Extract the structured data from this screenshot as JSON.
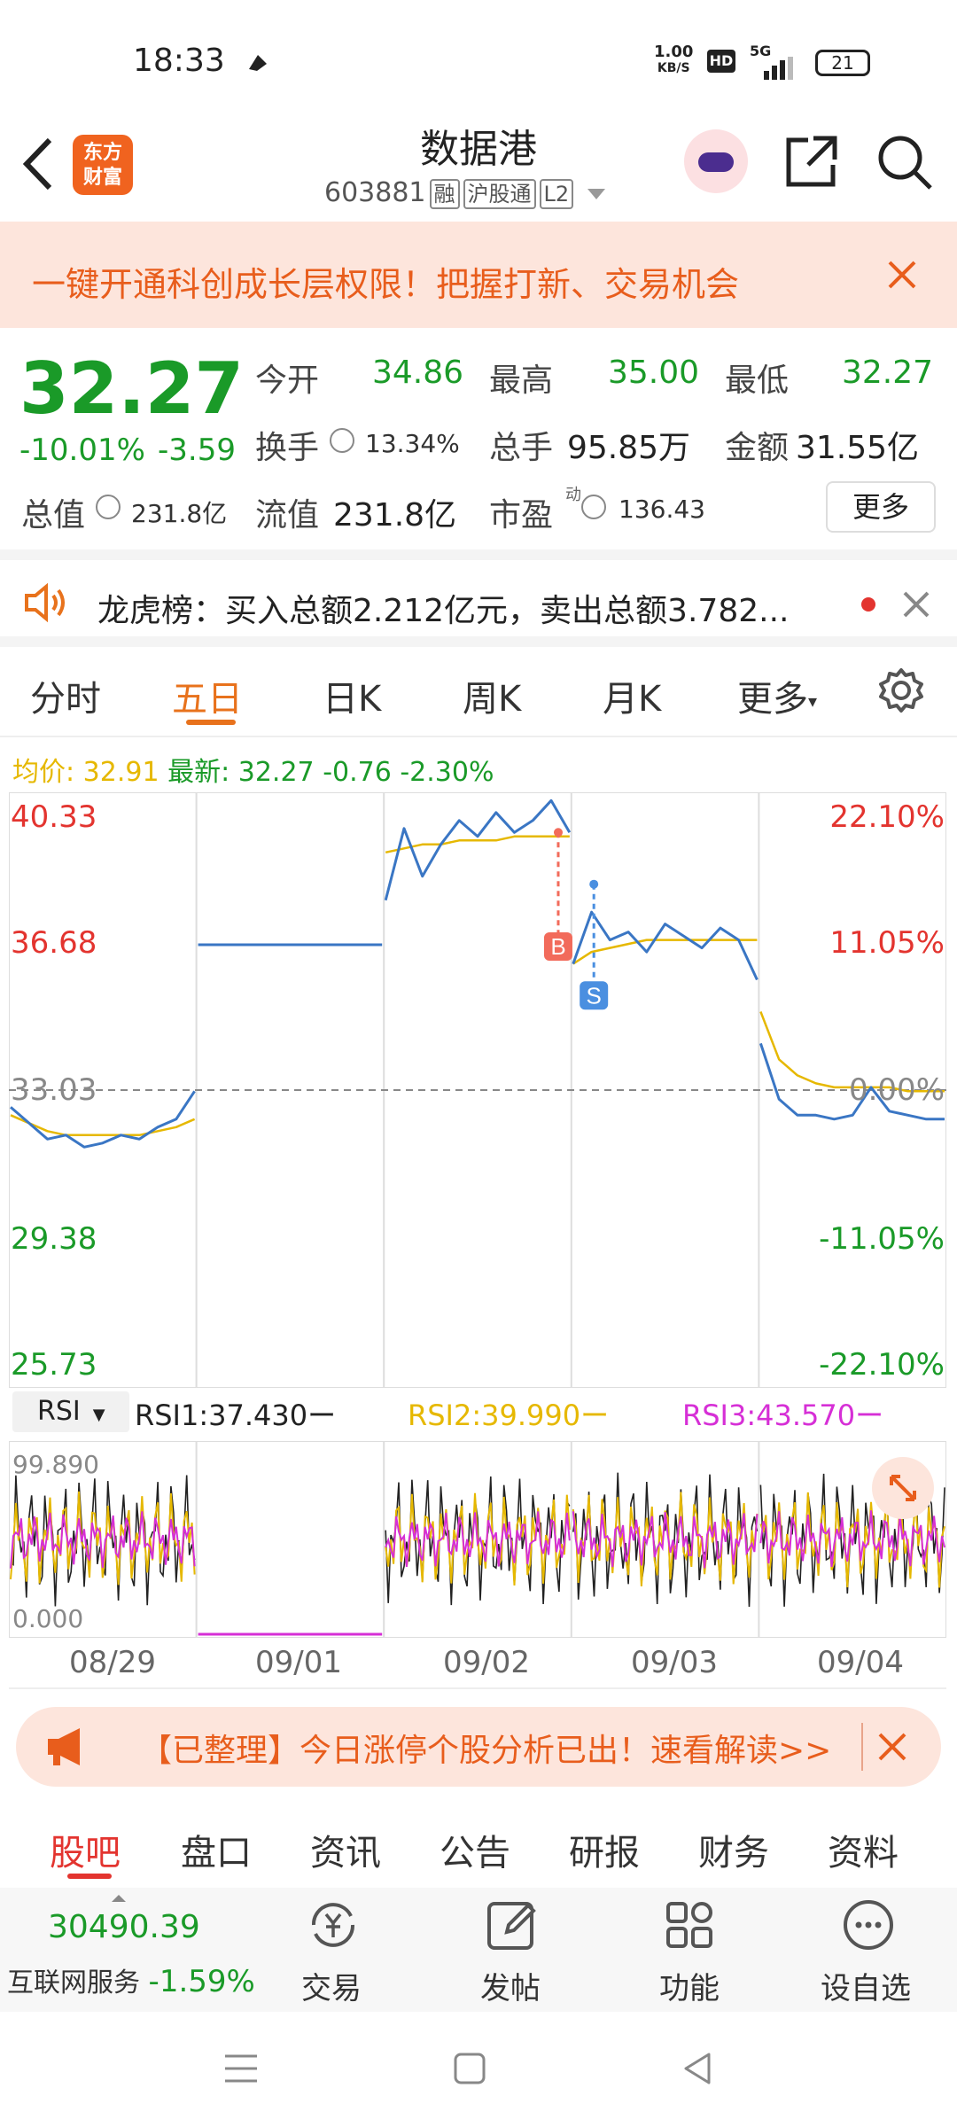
{
  "status_bar": {
    "time": "18:33",
    "net_speed": "1.00",
    "net_unit": "KB/S",
    "hd": "HD",
    "signal": "5G",
    "battery": "21"
  },
  "header": {
    "logo_line1": "东方",
    "logo_line2": "财富",
    "title": "数据港",
    "code": "603881",
    "tags": [
      "融",
      "沪股通",
      "L2"
    ]
  },
  "banner": {
    "text": "一键开通科创成长层权限！把握打新、交易机会"
  },
  "quote": {
    "price": "32.27",
    "change_pct": "-10.01%",
    "change": "-3.59",
    "open_label": "今开",
    "open": "34.86",
    "high_label": "最高",
    "high": "35.00",
    "low_label": "最低",
    "low": "32.27",
    "turnover_label": "换手",
    "turnover": "13.34%",
    "volume_label": "总手",
    "volume": "95.85万",
    "amount_label": "金额",
    "amount": "31.55亿",
    "mktcap_label": "总值",
    "mktcap": "231.8亿",
    "float_label": "流值",
    "float": "231.8亿",
    "pe_label": "市盈",
    "pe_sup": "动",
    "pe": "136.43",
    "more": "更多"
  },
  "notice": {
    "text": "龙虎榜：买入总额2.212亿元，卖出总额3.782..."
  },
  "chart_tabs": [
    "分时",
    "五日",
    "日K",
    "周K",
    "月K",
    "更多"
  ],
  "stats_line": {
    "avg_label": "均价:",
    "avg": "32.91",
    "latest_label": "最新:",
    "latest": "32.27",
    "chg": "-0.76",
    "pct": "-2.30%"
  },
  "chart_data": {
    "type": "line",
    "title": "",
    "x": [
      "08/29",
      "09/01",
      "09/02",
      "09/03",
      "09/04"
    ],
    "y_ticks_left": [
      "40.33",
      "36.68",
      "33.03",
      "29.38",
      "25.73"
    ],
    "y_ticks_right": [
      "22.10%",
      "11.05%",
      "0.00%",
      "-11.05%",
      "-22.10%"
    ],
    "ylim": [
      25.73,
      40.33
    ],
    "reference_close": 33.03,
    "markers": [
      {
        "label": "B",
        "value": 39.5
      },
      {
        "label": "S",
        "value": 38.2
      }
    ],
    "series": [
      {
        "values": [
          32.6,
          32.2,
          31.8,
          31.9,
          31.6,
          31.7,
          31.9,
          31.8,
          32.1,
          32.3,
          33.0
        ]
      },
      {
        "values": [
          36.68,
          36.68
        ]
      },
      {
        "values": [
          37.8,
          39.6,
          38.4,
          39.2,
          39.8,
          39.4,
          40.0,
          39.5,
          39.8,
          40.3,
          39.5
        ]
      },
      {
        "values": [
          36.2,
          37.5,
          36.8,
          37.0,
          36.5,
          37.2,
          36.9,
          36.6,
          37.1,
          36.8,
          35.8
        ]
      },
      {
        "values": [
          34.2,
          32.8,
          32.4,
          32.4,
          32.3,
          32.4,
          33.1,
          32.5,
          32.4,
          32.3,
          32.3
        ]
      }
    ],
    "avg_series": [
      {
        "values": [
          32.4,
          32.2,
          32.0,
          31.9,
          31.9,
          31.9,
          31.9,
          31.9,
          32.0,
          32.1,
          32.3
        ]
      },
      {
        "values": [
          39.0,
          39.1,
          39.2,
          39.2,
          39.3,
          39.3,
          39.3,
          39.4,
          39.4,
          39.4,
          39.4
        ]
      },
      {
        "values": [
          36.2,
          36.5,
          36.6,
          36.7,
          36.8,
          36.8,
          36.8,
          36.8,
          36.8,
          36.8,
          36.8
        ]
      },
      {
        "values": [
          35.0,
          33.8,
          33.4,
          33.2,
          33.1,
          33.1,
          33.1,
          33.1,
          33.0,
          33.0,
          33.0
        ]
      }
    ]
  },
  "rsi": {
    "selector": "RSI",
    "rsi1": "RSI1:37.430",
    "rsi2": "RSI2:39.990",
    "rsi3": "RSI3:43.570",
    "top": "99.890",
    "bottom": "0.000",
    "colors": {
      "rsi1": "#222222",
      "rsi2": "#e6b800",
      "rsi3": "#d62fd6"
    }
  },
  "ad": {
    "text": "【已整理】今日涨停个股分析已出！速看解读>>"
  },
  "bottom_tabs": [
    "股吧",
    "盘口",
    "资讯",
    "公告",
    "研报",
    "财务",
    "资料"
  ],
  "bottom_bar": {
    "index_value": "30490.39",
    "index_name": "互联网服务",
    "index_pct": "-1.59%",
    "items": [
      "交易",
      "发帖",
      "功能",
      "设自选"
    ]
  }
}
